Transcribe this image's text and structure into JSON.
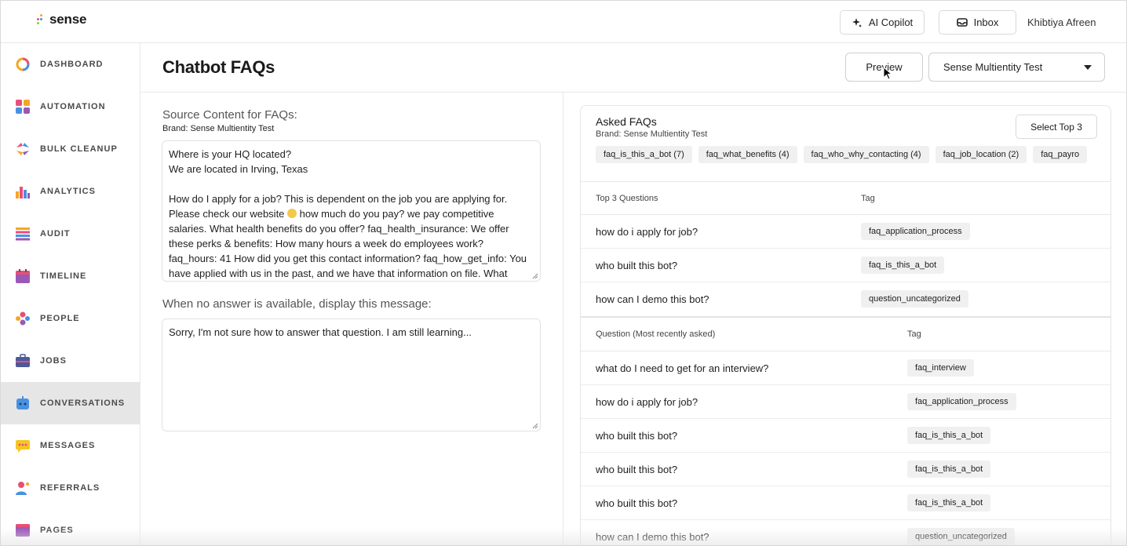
{
  "app": {
    "logo_text": "sense",
    "copilot_label": "AI Copilot",
    "inbox_label": "Inbox",
    "user_name": "Khibtiya Afreen"
  },
  "sidebar": {
    "items": [
      {
        "label": "DASHBOARD",
        "icon": "dashboard-icon"
      },
      {
        "label": "AUTOMATION",
        "icon": "automation-icon"
      },
      {
        "label": "BULK CLEANUP",
        "icon": "bulk-cleanup-icon"
      },
      {
        "label": "ANALYTICS",
        "icon": "analytics-icon"
      },
      {
        "label": "AUDIT",
        "icon": "audit-icon"
      },
      {
        "label": "TIMELINE",
        "icon": "timeline-icon"
      },
      {
        "label": "PEOPLE",
        "icon": "people-icon"
      },
      {
        "label": "JOBS",
        "icon": "jobs-icon"
      },
      {
        "label": "CONVERSATIONS",
        "icon": "conversations-icon"
      },
      {
        "label": "MESSAGES",
        "icon": "messages-icon"
      },
      {
        "label": "REFERRALS",
        "icon": "referrals-icon"
      },
      {
        "label": "PAGES",
        "icon": "pages-icon"
      }
    ],
    "active": "CONVERSATIONS"
  },
  "header": {
    "title": "Chatbot FAQs",
    "preview_label": "Preview",
    "brand_selected": "Sense Multientity Test"
  },
  "source": {
    "label": "Source Content for FAQs:",
    "brand": "Brand: Sense Multientity Test",
    "line1": "Where is your HQ located?",
    "line2": "We are located in Irving, Texas",
    "para_before_emoji": "How do I apply for a job? This is dependent on the job you are applying for. Please check our website",
    "para_after_emoji": "how much do you pay? we pay competitive salaries. What health benefits do you offer? faq_health_insurance: We offer these perks & benefits: How many hours a week do employees work? faq_hours: 41 How did you get this contact information? faq_how_get_info: You have applied with us in the past, and we have that information on file. What"
  },
  "fallback": {
    "label": "When no answer is available, display this message:",
    "text": "Sorry, I'm not sure how to answer that question. I am still learning..."
  },
  "asked_faqs": {
    "title": "Asked FAQs",
    "brand": "Brand: Sense Multientity Test",
    "select_top_label": "Select Top 3",
    "chips": [
      "faq_is_this_a_bot (7)",
      "faq_what_benefits (4)",
      "faq_who_why_contacting (4)",
      "faq_job_location (2)",
      "faq_payro"
    ],
    "top_header": {
      "question": "Top 3 Questions",
      "tag": "Tag"
    },
    "top_rows": [
      {
        "question": "how do i apply for job?",
        "tag": "faq_application_process"
      },
      {
        "question": "who built this bot?",
        "tag": "faq_is_this_a_bot"
      },
      {
        "question": "how can I demo this bot?",
        "tag": "question_uncategorized"
      }
    ],
    "recent_header": {
      "question": "Question (Most recently asked)",
      "tag": "Tag"
    },
    "recent_rows": [
      {
        "question": "what do I need to get for an interview?",
        "tag": "faq_interview"
      },
      {
        "question": "how do i apply for job?",
        "tag": "faq_application_process"
      },
      {
        "question": "who built this bot?",
        "tag": "faq_is_this_a_bot"
      },
      {
        "question": "who built this bot?",
        "tag": "faq_is_this_a_bot"
      },
      {
        "question": "who built this bot?",
        "tag": "faq_is_this_a_bot"
      },
      {
        "question": "how can I demo this bot?",
        "tag": "question_uncategorized"
      }
    ]
  },
  "colors": {
    "active_nav_bg": "#e6e6e6",
    "chip_bg": "#f0f0f0",
    "logo_dots": [
      "#f5a623",
      "#e94e77",
      "#4a90e2",
      "#7ed321"
    ]
  }
}
